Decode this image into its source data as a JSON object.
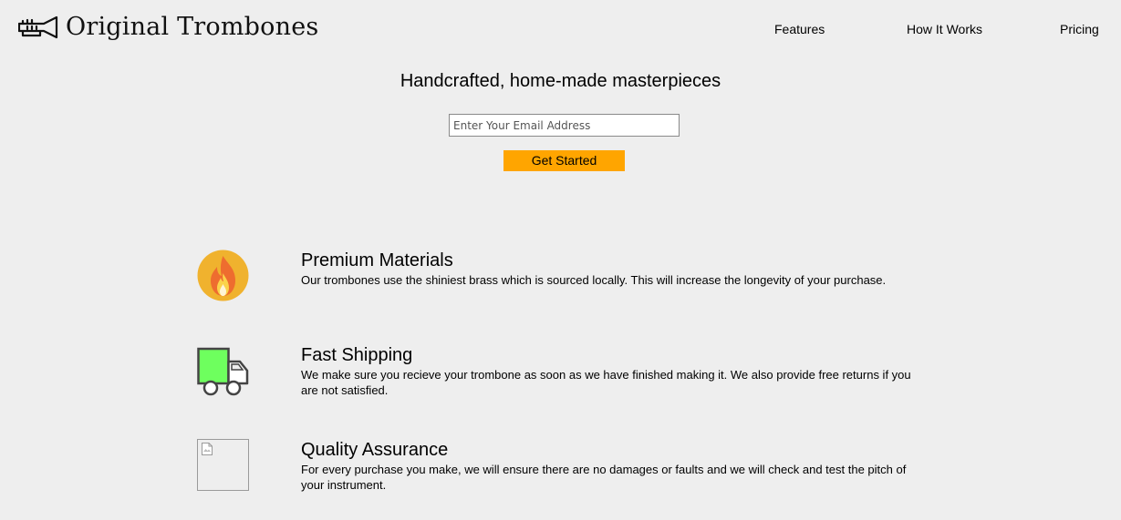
{
  "header": {
    "brand_name": "Original Trombones",
    "logo_icon": "trombone-logo-icon",
    "nav": {
      "features": "Features",
      "how_it_works": "How It Works",
      "pricing": "Pricing"
    }
  },
  "hero": {
    "title": "Handcrafted, home-made masterpieces",
    "email_placeholder": "Enter Your Email Address",
    "email_value": "",
    "cta_label": "Get Started",
    "cta_color": "#ffa500"
  },
  "features": [
    {
      "icon": "flame-icon",
      "title": "Premium Materials",
      "description": "Our trombones use the shiniest brass which is sourced locally. This will increase the longevity of your purchase."
    },
    {
      "icon": "truck-icon",
      "title": "Fast Shipping",
      "description": "We make sure you recieve your trombone as soon as we have finished making it. We also provide free returns if you are not satisfied."
    },
    {
      "icon": "broken-image-icon",
      "title": "Quality Assurance",
      "description": "For every purchase you make, we will ensure there are no damages or faults and we will check and test the pitch of your instrument."
    }
  ],
  "colors": {
    "background": "#eeeeee",
    "accent": "#ffa500",
    "flame_circle": "#f0b22e",
    "truck_body": "#6eff5e"
  }
}
